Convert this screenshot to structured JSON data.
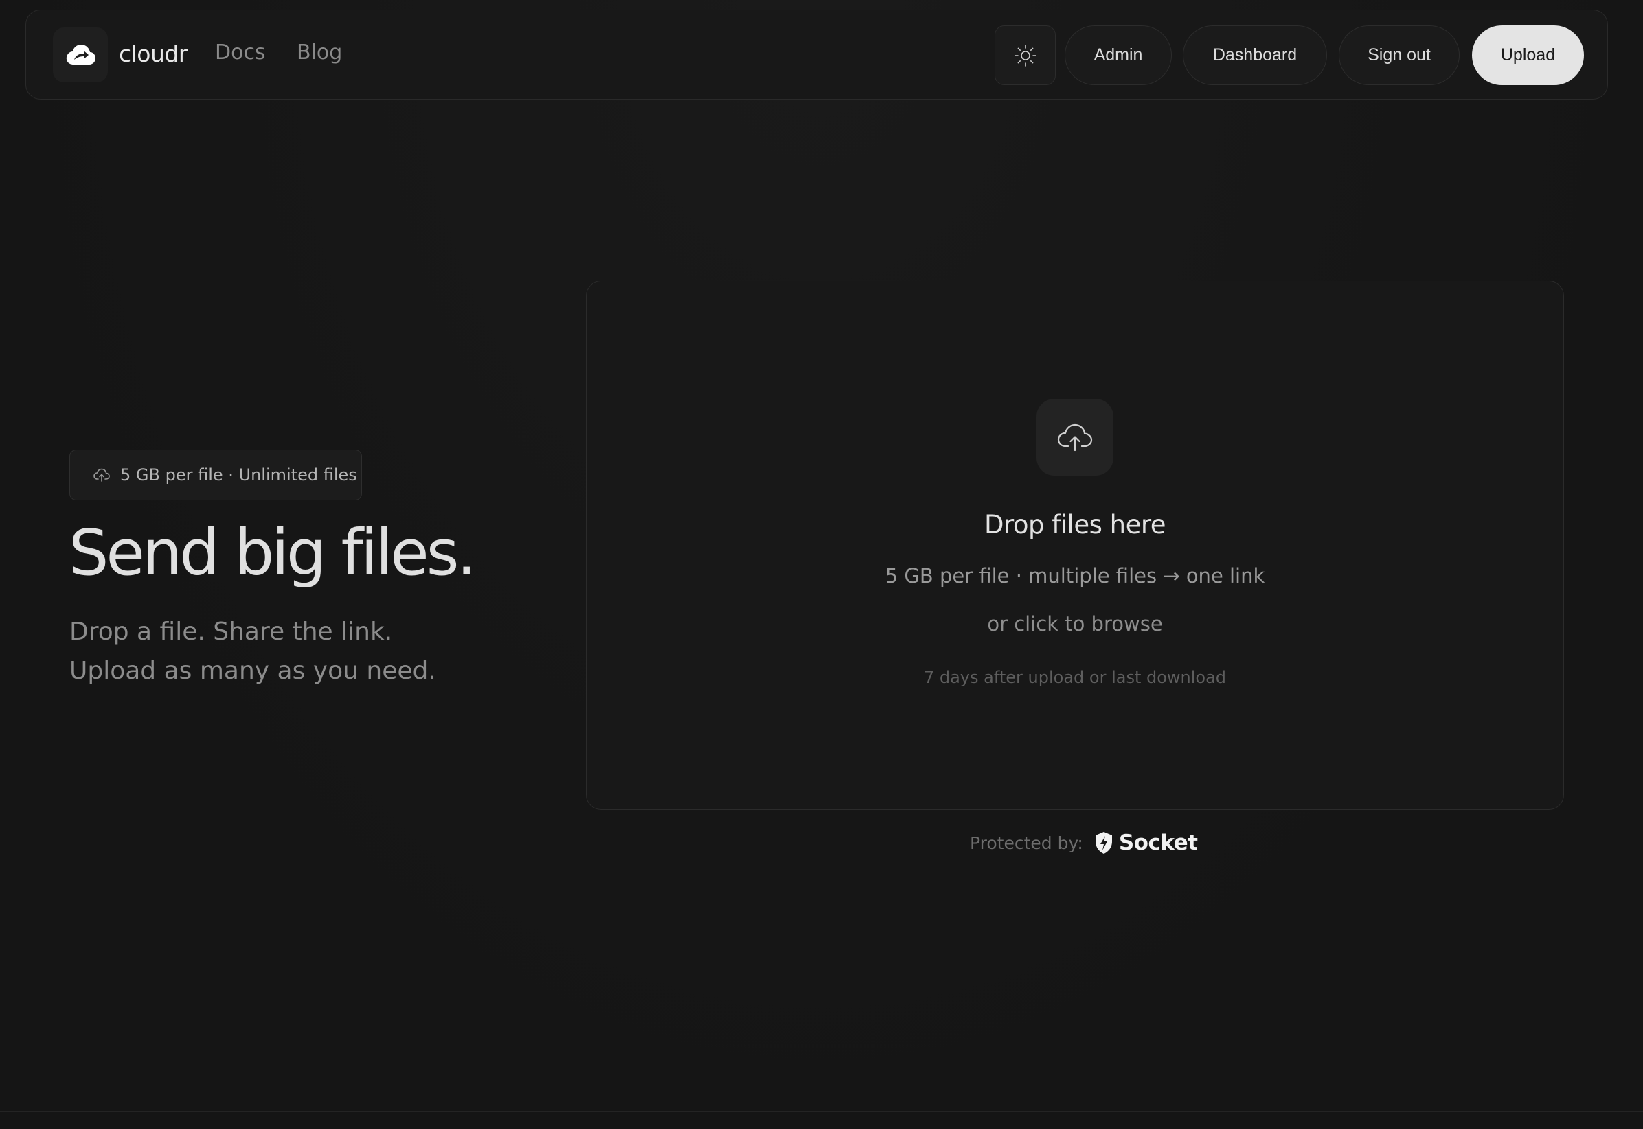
{
  "nav": {
    "brand": "cloudr",
    "links": [
      "Docs",
      "Blog"
    ],
    "theme_icon": "sun-icon",
    "buttons": {
      "admin": "Admin",
      "dashboard": "Dashboard",
      "sign_out": "Sign out",
      "upload": "Upload"
    }
  },
  "hero": {
    "badge": "5 GB per file · Unlimited files",
    "title": "Send big files.",
    "subtitle_line1": "Drop a file. Share the link.",
    "subtitle_line2": "Upload as many as you need."
  },
  "dropzone": {
    "icon": "cloud-upload-icon",
    "title": "Drop files here",
    "limit": "5 GB per file · multiple files → one link",
    "browse": "or click to browse",
    "expiry": "7 days after upload or last download"
  },
  "protection": {
    "label": "Protected by:",
    "brand": "Socket"
  },
  "colors": {
    "background": "#161616",
    "primary_button": "#e4e4e4",
    "text": "#e0e0e0",
    "muted": "#8c8c8c"
  }
}
